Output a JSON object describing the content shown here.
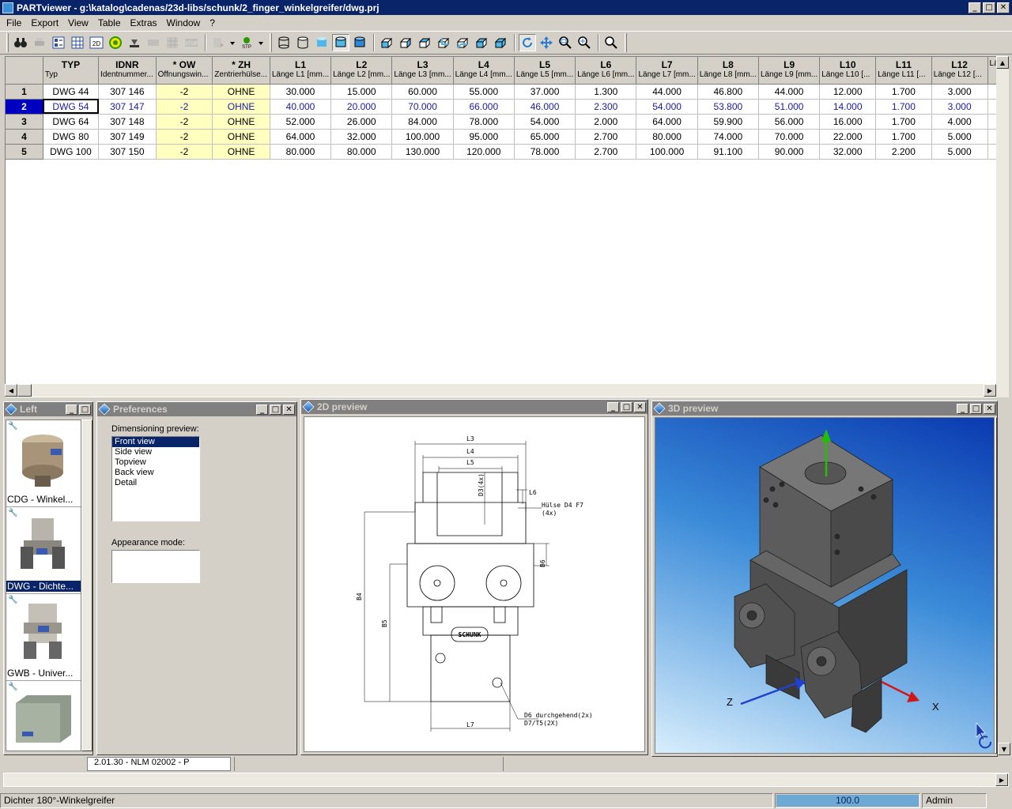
{
  "window": {
    "title": "PARTviewer - g:\\katalog\\cadenas/23d-libs/schunk/2_finger_winkelgreifer/dwg.prj",
    "minimize": "_",
    "maximize": "□",
    "close": "✕"
  },
  "menu": [
    "File",
    "Export",
    "View",
    "Table",
    "Extras",
    "Window",
    "?"
  ],
  "toolbar": {
    "buttons": [
      "binoculars-icon",
      "print-icon",
      "tree-icon",
      "table-icon",
      "2d-icon",
      "globe-icon",
      "tools-icon",
      "keyboard-icon",
      "grid-icon",
      "stop-icon",
      "export-icon",
      "stp-icon",
      "wireframe-icon",
      "hidden-line-icon",
      "shaded-icon",
      "shaded-edges-icon",
      "solid-icon",
      "view-front-icon",
      "view-side-icon",
      "view-top-icon",
      "view-back-icon",
      "view-iso-icon",
      "view-iso2-icon",
      "view-iso3-icon",
      "rotate-icon",
      "pan-icon",
      "zoom-window-icon",
      "zoom-fit-icon",
      "zoom-icon"
    ],
    "2d_label": "2D",
    "stop_label": "STOP",
    "stp_label": "STP"
  },
  "table": {
    "columns": [
      {
        "key": "TYP",
        "desc": "Typ"
      },
      {
        "key": "IDNR",
        "desc": "Identnummer..."
      },
      {
        "key": "* OW",
        "desc": "Öffnungswin..."
      },
      {
        "key": "* ZH",
        "desc": "Zentrierhülse..."
      },
      {
        "key": "L1",
        "desc": "Länge L1 [mm..."
      },
      {
        "key": "L2",
        "desc": "Länge L2 [mm..."
      },
      {
        "key": "L3",
        "desc": "Länge L3 [mm..."
      },
      {
        "key": "L4",
        "desc": "Länge L4 [mm..."
      },
      {
        "key": "L5",
        "desc": "Länge L5 [mm..."
      },
      {
        "key": "L6",
        "desc": "Länge L6 [mm..."
      },
      {
        "key": "L7",
        "desc": "Länge L7 [mm..."
      },
      {
        "key": "L8",
        "desc": "Länge L8 [mm..."
      },
      {
        "key": "L9",
        "desc": "Länge L9 [mm..."
      },
      {
        "key": "L10",
        "desc": "Länge L10 [..."
      },
      {
        "key": "L11",
        "desc": "Länge L11 [..."
      },
      {
        "key": "L12",
        "desc": "Länge L12 [..."
      },
      {
        "key": "",
        "desc": "Lä"
      }
    ],
    "rows": [
      {
        "n": "1",
        "cells": [
          "DWG 44",
          "307 146",
          "-2",
          "OHNE",
          "30.000",
          "15.000",
          "60.000",
          "55.000",
          "37.000",
          "1.300",
          "44.000",
          "46.800",
          "44.000",
          "12.000",
          "1.700",
          "3.000"
        ]
      },
      {
        "n": "2",
        "cells": [
          "DWG 54",
          "307 147",
          "-2",
          "OHNE",
          "40.000",
          "20.000",
          "70.000",
          "66.000",
          "46.000",
          "2.300",
          "54.000",
          "53.800",
          "51.000",
          "14.000",
          "1.700",
          "3.000"
        ]
      },
      {
        "n": "3",
        "cells": [
          "DWG 64",
          "307 148",
          "-2",
          "OHNE",
          "52.000",
          "26.000",
          "84.000",
          "78.000",
          "54.000",
          "2.000",
          "64.000",
          "59.900",
          "56.000",
          "16.000",
          "1.700",
          "4.000"
        ]
      },
      {
        "n": "4",
        "cells": [
          "DWG 80",
          "307 149",
          "-2",
          "OHNE",
          "64.000",
          "32.000",
          "100.000",
          "95.000",
          "65.000",
          "2.700",
          "80.000",
          "74.000",
          "70.000",
          "22.000",
          "1.700",
          "5.000"
        ]
      },
      {
        "n": "5",
        "cells": [
          "DWG 100",
          "307 150",
          "-2",
          "OHNE",
          "80.000",
          "80.000",
          "130.000",
          "120.000",
          "78.000",
          "2.700",
          "100.000",
          "91.100",
          "90.000",
          "32.000",
          "2.200",
          "5.000"
        ]
      }
    ],
    "selected_row": 1
  },
  "left_panel": {
    "title": "Left",
    "items": [
      {
        "label": "CDG - Winkel..."
      },
      {
        "label": "DWG - Dichte..."
      },
      {
        "label": "GWB - Univer..."
      },
      {
        "label": ""
      }
    ],
    "behind_text": "2.01.30 - NLM 02002 -  P"
  },
  "preferences": {
    "title": "Preferences",
    "dimensioning_label": "Dimensioning preview:",
    "views": [
      "Front view",
      "Side view",
      "Topview",
      "Back view",
      "Detail"
    ],
    "appearance_label": "Appearance mode:"
  },
  "preview2d": {
    "title": "2D preview",
    "labels": {
      "L3": "L3",
      "L4": "L4",
      "L5": "L5",
      "L6": "L6",
      "L7": "L7",
      "B4": "B4",
      "B5": "B5",
      "B6": "B6",
      "D3": "D3(4x)",
      "huelse": "Hülse D4 F7",
      "huelse2": "(4x)",
      "d6": "D6 durchgehend(2x)",
      "d7": "D7/T5(2X)",
      "brand": "SCHUNK"
    }
  },
  "preview3d": {
    "title": "3D preview",
    "axis_x": "X",
    "axis_z": "Z"
  },
  "status": {
    "text": "Dichter 180°-Winkelgreifer",
    "progress": "100.0",
    "progress_value": 1.0,
    "user": "Admin"
  }
}
